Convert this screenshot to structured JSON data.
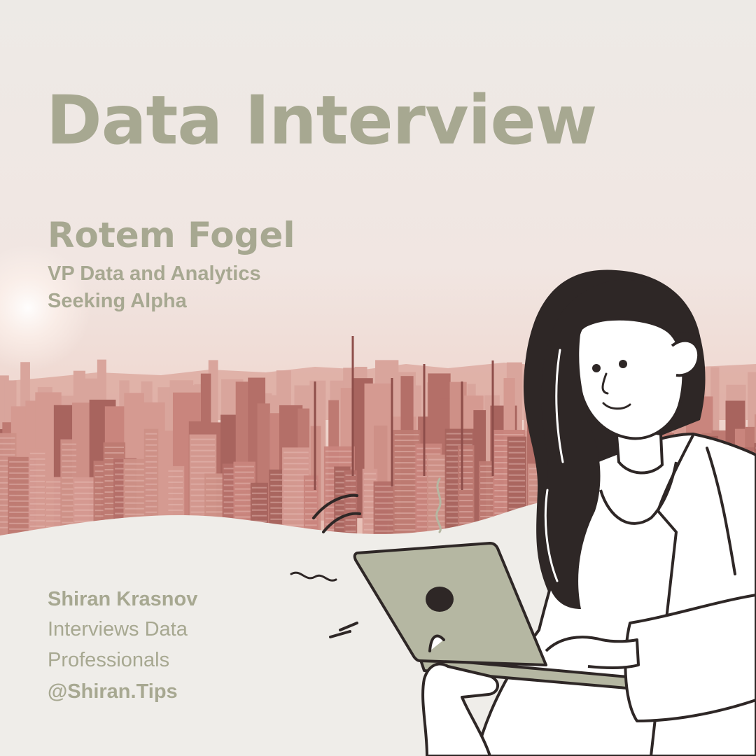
{
  "header": {
    "title": "Data Interview"
  },
  "guest": {
    "name": "Rotem Fogel",
    "role": "VP Data and Analytics",
    "company": "Seeking Alpha"
  },
  "host": {
    "name": "Shiran Krasnov",
    "tagline_line1": "Interviews Data",
    "tagline_line2": "Professionals",
    "handle": "@Shiran.Tips"
  },
  "colors": {
    "text_sage": "#A7A891",
    "background_cream": "#EFEDE9",
    "city_tint": "#C98C84",
    "hair": "#2E2726",
    "laptop": "#B5B7A2"
  },
  "illustration": {
    "subject": "woman-with-laptop",
    "background": "city-skyline-sunset"
  }
}
